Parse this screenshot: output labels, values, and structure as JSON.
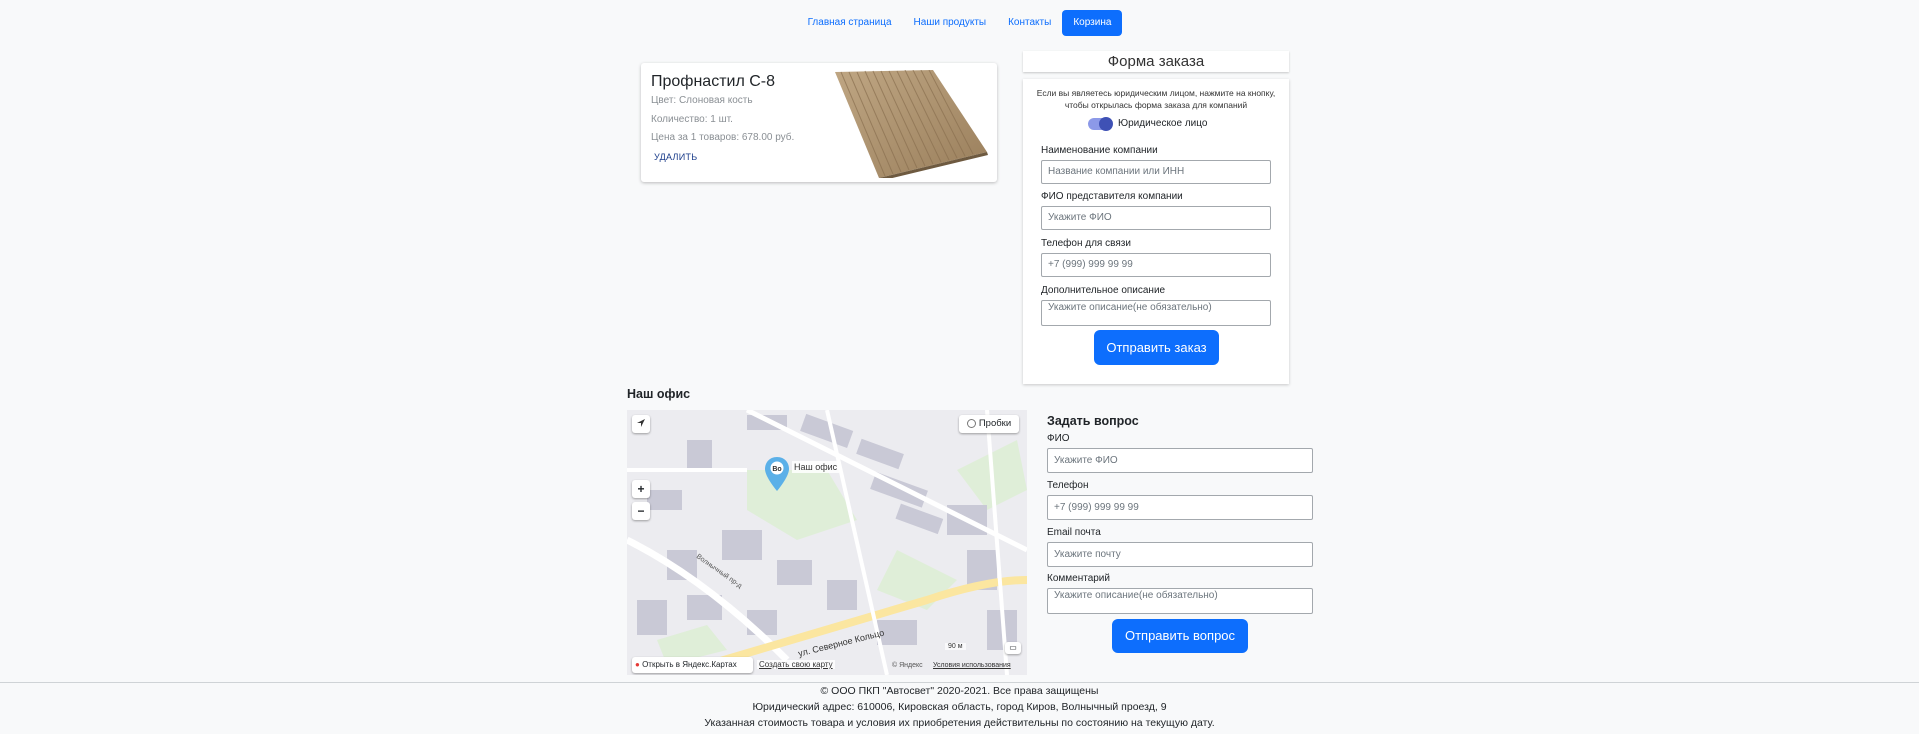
{
  "nav": {
    "items": [
      {
        "label": "Главная страница"
      },
      {
        "label": "Наши продукты"
      },
      {
        "label": "Контакты"
      },
      {
        "label": "Корзина",
        "active": true
      }
    ]
  },
  "cart": {
    "item": {
      "title": "Профнастил С-8",
      "color": "Цвет: Слоновая кость",
      "quantity": "Количество: 1 шт.",
      "price": "Цена за 1 товаров: 678.00 руб.",
      "delete_label": "УДАЛИТЬ"
    }
  },
  "order_form": {
    "title": "Форма заказа",
    "hint": "Если вы являетесь юридическим лицом, нажмите на кнопку, чтобы открылась форма заказа для компаний",
    "toggle_label": "Юридическое лицо",
    "toggle_on": true,
    "fields": [
      {
        "label": "Наименование компании",
        "placeholder": "Название компании или ИНН"
      },
      {
        "label": "ФИО представителя компании",
        "placeholder": "Укажите ФИО"
      },
      {
        "label": "Телефон для связи",
        "placeholder": "+7 (999) 999 99 99"
      },
      {
        "label": "Дополнительное описание",
        "placeholder": "Укажите описание(не обязательно)"
      }
    ],
    "submit_label": "Отправить заказ"
  },
  "office": {
    "title": "Наш офис",
    "map": {
      "marker_label": "Наш офис",
      "traffic_label": "Пробки",
      "zoom_in": "+",
      "zoom_out": "−",
      "street_1": "ул. Северное Кольцо",
      "street_2": "Волнычный пр-д",
      "scale": "90 м",
      "open_link": "Открыть в Яндекс.Картах",
      "create_link": "Создать свою карту",
      "copyright": "© Яндекс",
      "terms": "Условия использования"
    }
  },
  "question_form": {
    "title": "Задать вопрос",
    "fields": [
      {
        "label": "ФИО",
        "placeholder": "Укажите ФИО"
      },
      {
        "label": "Телефон",
        "placeholder": "+7 (999) 999 99 99"
      },
      {
        "label": "Email почта",
        "placeholder": "Укажите почту"
      },
      {
        "label": "Комментарий",
        "placeholder": "Укажите описание(не обязательно)"
      }
    ],
    "submit_label": "Отправить вопрос"
  },
  "footer": {
    "line1": "© ООО ПКП \"Автосвет\" 2020-2021. Все права защищены",
    "line2": "Юридический адрес: 610006, Кировская область, город Киров, Волнычный проезд, 9",
    "line3": "Указанная стоимость товара и условия их приобретения действительны по состоянию на текущую дату."
  },
  "colors": {
    "primary": "#0d6efd",
    "background": "#f8f9fa",
    "toggle": "#3f51b5"
  }
}
